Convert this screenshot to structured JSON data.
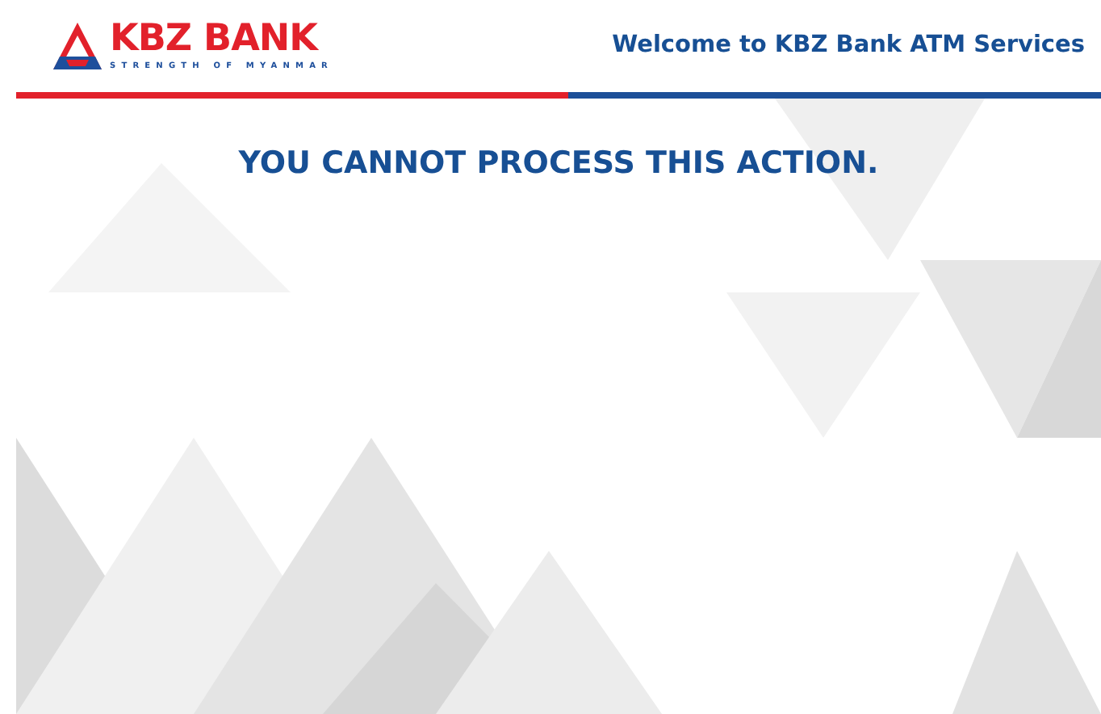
{
  "header": {
    "brand": "KBZ BANK",
    "tagline": "STRENGTH OF MYANMAR",
    "welcome": "Welcome to KBZ Bank ATM Services"
  },
  "message": "YOU CANNOT PROCESS THIS ACTION."
}
